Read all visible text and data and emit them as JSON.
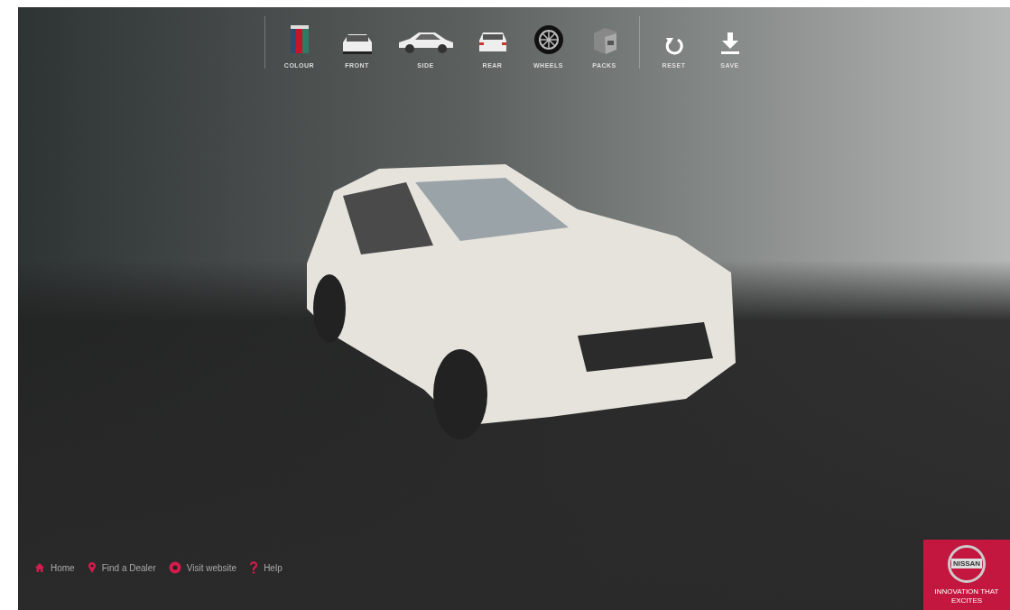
{
  "toolbar": {
    "groups": [
      [
        {
          "kind": "colour",
          "label": "COLOUR"
        },
        {
          "kind": "front",
          "label": "FRONT"
        },
        {
          "kind": "side",
          "label": "SIDE"
        },
        {
          "kind": "rear",
          "label": "REAR"
        },
        {
          "kind": "wheels",
          "label": "WHEELS"
        },
        {
          "kind": "packs",
          "label": "PACKS"
        }
      ],
      [
        {
          "kind": "reset",
          "label": "RESET"
        },
        {
          "kind": "save",
          "label": "SAVE"
        }
      ]
    ]
  },
  "footer_links": [
    {
      "kind": "home",
      "label": "Home"
    },
    {
      "kind": "pin",
      "label": "Find a Dealer"
    },
    {
      "kind": "globe",
      "label": "Visit website"
    },
    {
      "kind": "help",
      "label": "Help"
    }
  ],
  "logo": {
    "name": "NISSAN",
    "tagline": "INNOVATION THAT EXCITES"
  }
}
